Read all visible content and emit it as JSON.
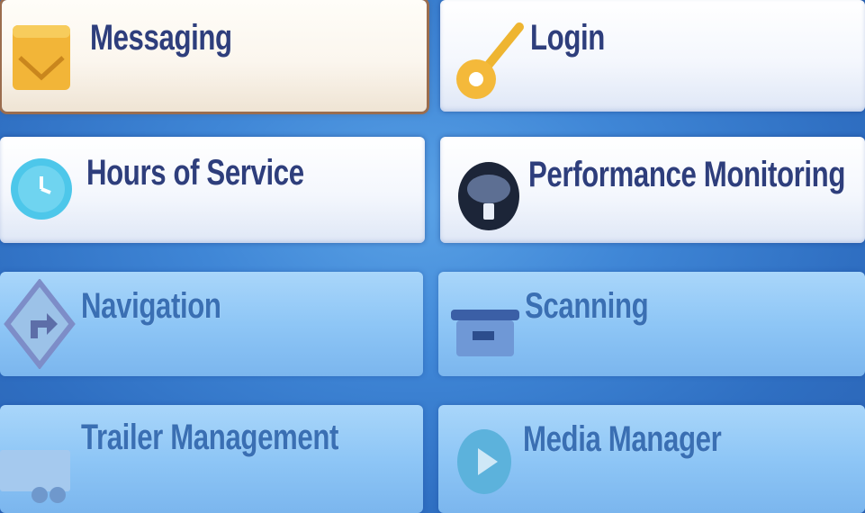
{
  "menu": {
    "tiles": [
      {
        "label": "Messaging",
        "icon": "envelope-icon",
        "selected": true
      },
      {
        "label": "Login",
        "icon": "key-icon",
        "selected": false
      },
      {
        "label": "Hours of Service",
        "icon": "clock-icon",
        "selected": false
      },
      {
        "label": "Performance Monitoring",
        "icon": "gauge-icon",
        "selected": false
      },
      {
        "label": "Navigation",
        "icon": "road-sign-icon",
        "selected": false
      },
      {
        "label": "Scanning",
        "icon": "scanner-icon",
        "selected": false
      },
      {
        "label": "Trailer Management",
        "icon": "trailer-icon",
        "selected": false
      },
      {
        "label": "Media Manager",
        "icon": "play-icon",
        "selected": false
      }
    ]
  },
  "colors": {
    "background": "#3f86d6",
    "light_tile_text": "#2e3e7c",
    "blue_tile_text": "#3a6fb3",
    "selected_border": "#9b6d4e"
  }
}
